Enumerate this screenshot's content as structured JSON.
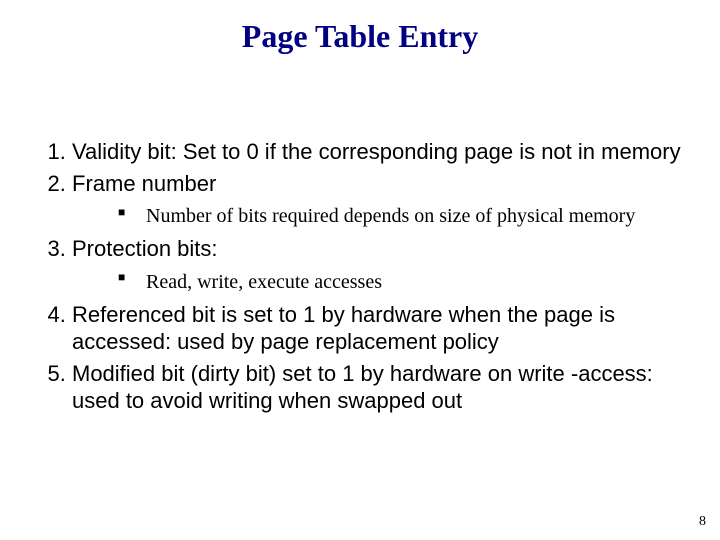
{
  "title": "Page Table Entry",
  "items": [
    {
      "text": "Validity bit: Set to 0 if the corresponding page is not in memory",
      "sub": []
    },
    {
      "text": "Frame number",
      "sub": [
        "Number of bits required depends on size of physical memory"
      ]
    },
    {
      "text": "Protection bits:",
      "sub": [
        "Read, write, execute accesses"
      ]
    },
    {
      "text": "Referenced bit is set to 1 by hardware when the page is accessed: used by page replacement policy",
      "sub": []
    },
    {
      "text": "Modified bit (dirty bit) set to 1 by hardware on write -access: used to avoid writing when swapped out",
      "sub": []
    }
  ],
  "page_number": "8"
}
